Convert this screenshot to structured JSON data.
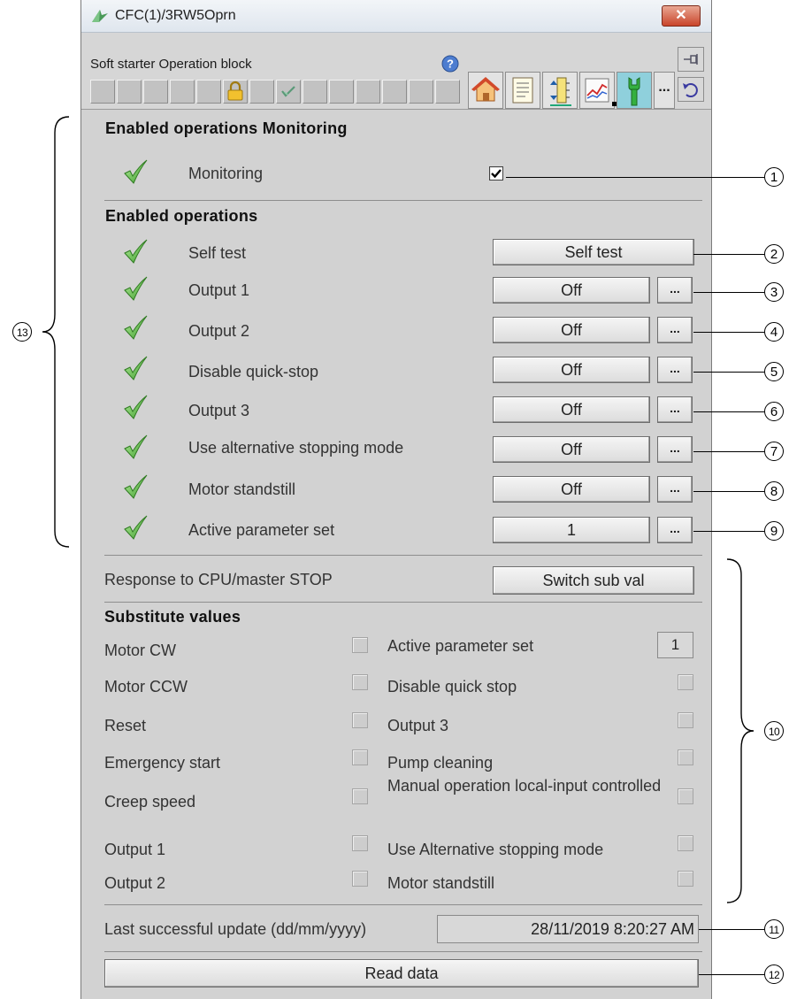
{
  "window": {
    "title": "CFC(1)/3RW5Oprn",
    "close_label": "✕"
  },
  "toolbar": {
    "block_name": "Soft starter Operation block",
    "more_label": "..."
  },
  "monitoring_section": {
    "heading": "Enabled operations Monitoring",
    "item_label": "Monitoring",
    "checked": true
  },
  "operations_section": {
    "heading": "Enabled operations",
    "items": [
      {
        "label": "Self test",
        "button": "Self test"
      },
      {
        "label": "Output 1",
        "button": "Off"
      },
      {
        "label": "Output 2",
        "button": "Off"
      },
      {
        "label": "Disable quick-stop",
        "button": "Off"
      },
      {
        "label": "Output 3",
        "button": "Off"
      },
      {
        "label": "Use alternative stopping mode",
        "button": "Off"
      },
      {
        "label": "Motor standstill",
        "button": "Off"
      },
      {
        "label": "Active parameter set",
        "button": "1"
      }
    ],
    "dots_label": "..."
  },
  "response": {
    "label": "Response to CPU/master STOP",
    "button": "Switch sub val"
  },
  "substitute": {
    "heading": "Substitute values",
    "left": [
      "Motor CW",
      "Motor CCW",
      "Reset",
      "Emergency start",
      "Creep speed",
      "Output 1",
      "Output 2"
    ],
    "right": [
      "Active parameter set",
      "Disable quick stop",
      "Output 3",
      "Pump cleaning",
      "Manual operation local-input controlled",
      "Use Alternative stopping mode",
      "Motor standstill"
    ],
    "active_param_value": "1"
  },
  "last_update": {
    "label": "Last successful update (dd/mm/yyyy)",
    "value": "28/11/2019  8:20:27 AM"
  },
  "read_button": "Read data",
  "callouts": [
    "1",
    "2",
    "3",
    "4",
    "5",
    "6",
    "7",
    "8",
    "9",
    "10",
    "11",
    "12",
    "13"
  ]
}
